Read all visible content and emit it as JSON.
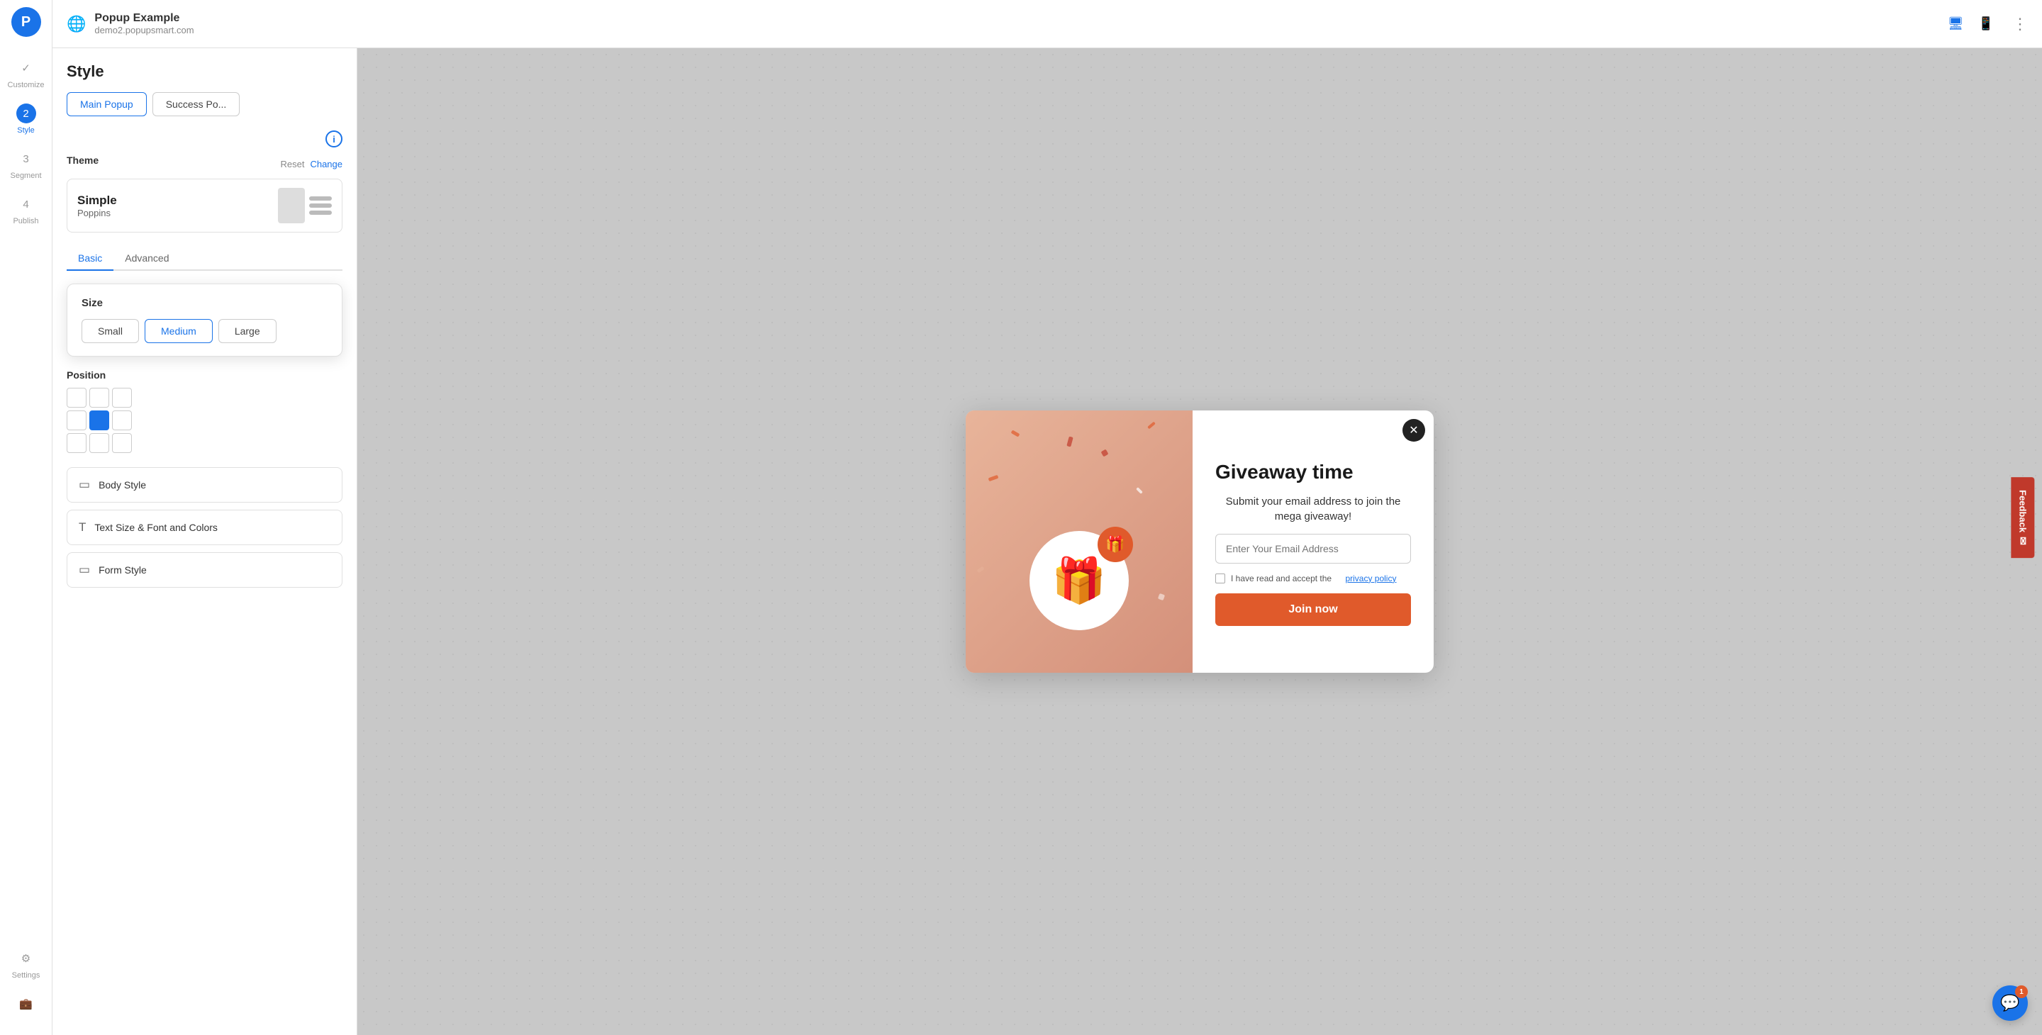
{
  "app": {
    "logo": "P",
    "title": "Popup Example",
    "subtitle": "demo2.popupsmart.com"
  },
  "nav": {
    "items": [
      {
        "id": "customize",
        "label": "Customize",
        "icon": "✓",
        "step": null,
        "active": false
      },
      {
        "id": "style",
        "label": "Style",
        "icon": null,
        "step": "2",
        "active": true
      },
      {
        "id": "segment",
        "label": "Segment",
        "icon": null,
        "step": "3",
        "active": false
      },
      {
        "id": "publish",
        "label": "Publish",
        "icon": null,
        "step": "4",
        "active": false
      }
    ],
    "settings_label": "Settings"
  },
  "header": {
    "title": "Popup Example",
    "subtitle": "demo2.popupsmart.com",
    "devices": [
      "desktop",
      "tablet"
    ],
    "more_icon": "⋮"
  },
  "left_panel": {
    "title": "Style",
    "popup_tabs": [
      {
        "label": "Main Popup",
        "active": true
      },
      {
        "label": "Success Po...",
        "active": false
      }
    ],
    "theme": {
      "section_label": "Theme",
      "reset_label": "Reset",
      "change_label": "Change",
      "name": "Simple",
      "font": "Poppins"
    },
    "tabs": [
      {
        "label": "Basic",
        "active": true
      },
      {
        "label": "Advanced",
        "active": false
      }
    ],
    "size": {
      "label": "Size",
      "options": [
        {
          "label": "Small",
          "active": false
        },
        {
          "label": "Medium",
          "active": true
        },
        {
          "label": "Large",
          "active": false
        }
      ]
    },
    "position": {
      "label": "Position",
      "selected": 4
    },
    "sections": [
      {
        "id": "body-style",
        "icon": "▭",
        "label": "Body Style"
      },
      {
        "id": "text-size",
        "icon": "T",
        "label": "Text Size & Font and Colors"
      },
      {
        "id": "form-style",
        "icon": "▭",
        "label": "Form Style"
      }
    ]
  },
  "popup_preview": {
    "close_icon": "✕",
    "heading": "Giveaway time",
    "subtext": "Submit your email address to join the mega giveaway!",
    "email_placeholder": "Enter Your Email Address",
    "checkbox_text": "I have read and accept the",
    "privacy_text": "privacy policy",
    "join_button": "Join now",
    "gift_emoji": "🎁",
    "badge_emoji": "🎁"
  },
  "feedback": {
    "label": "Feedback"
  },
  "chat": {
    "badge": "1"
  }
}
